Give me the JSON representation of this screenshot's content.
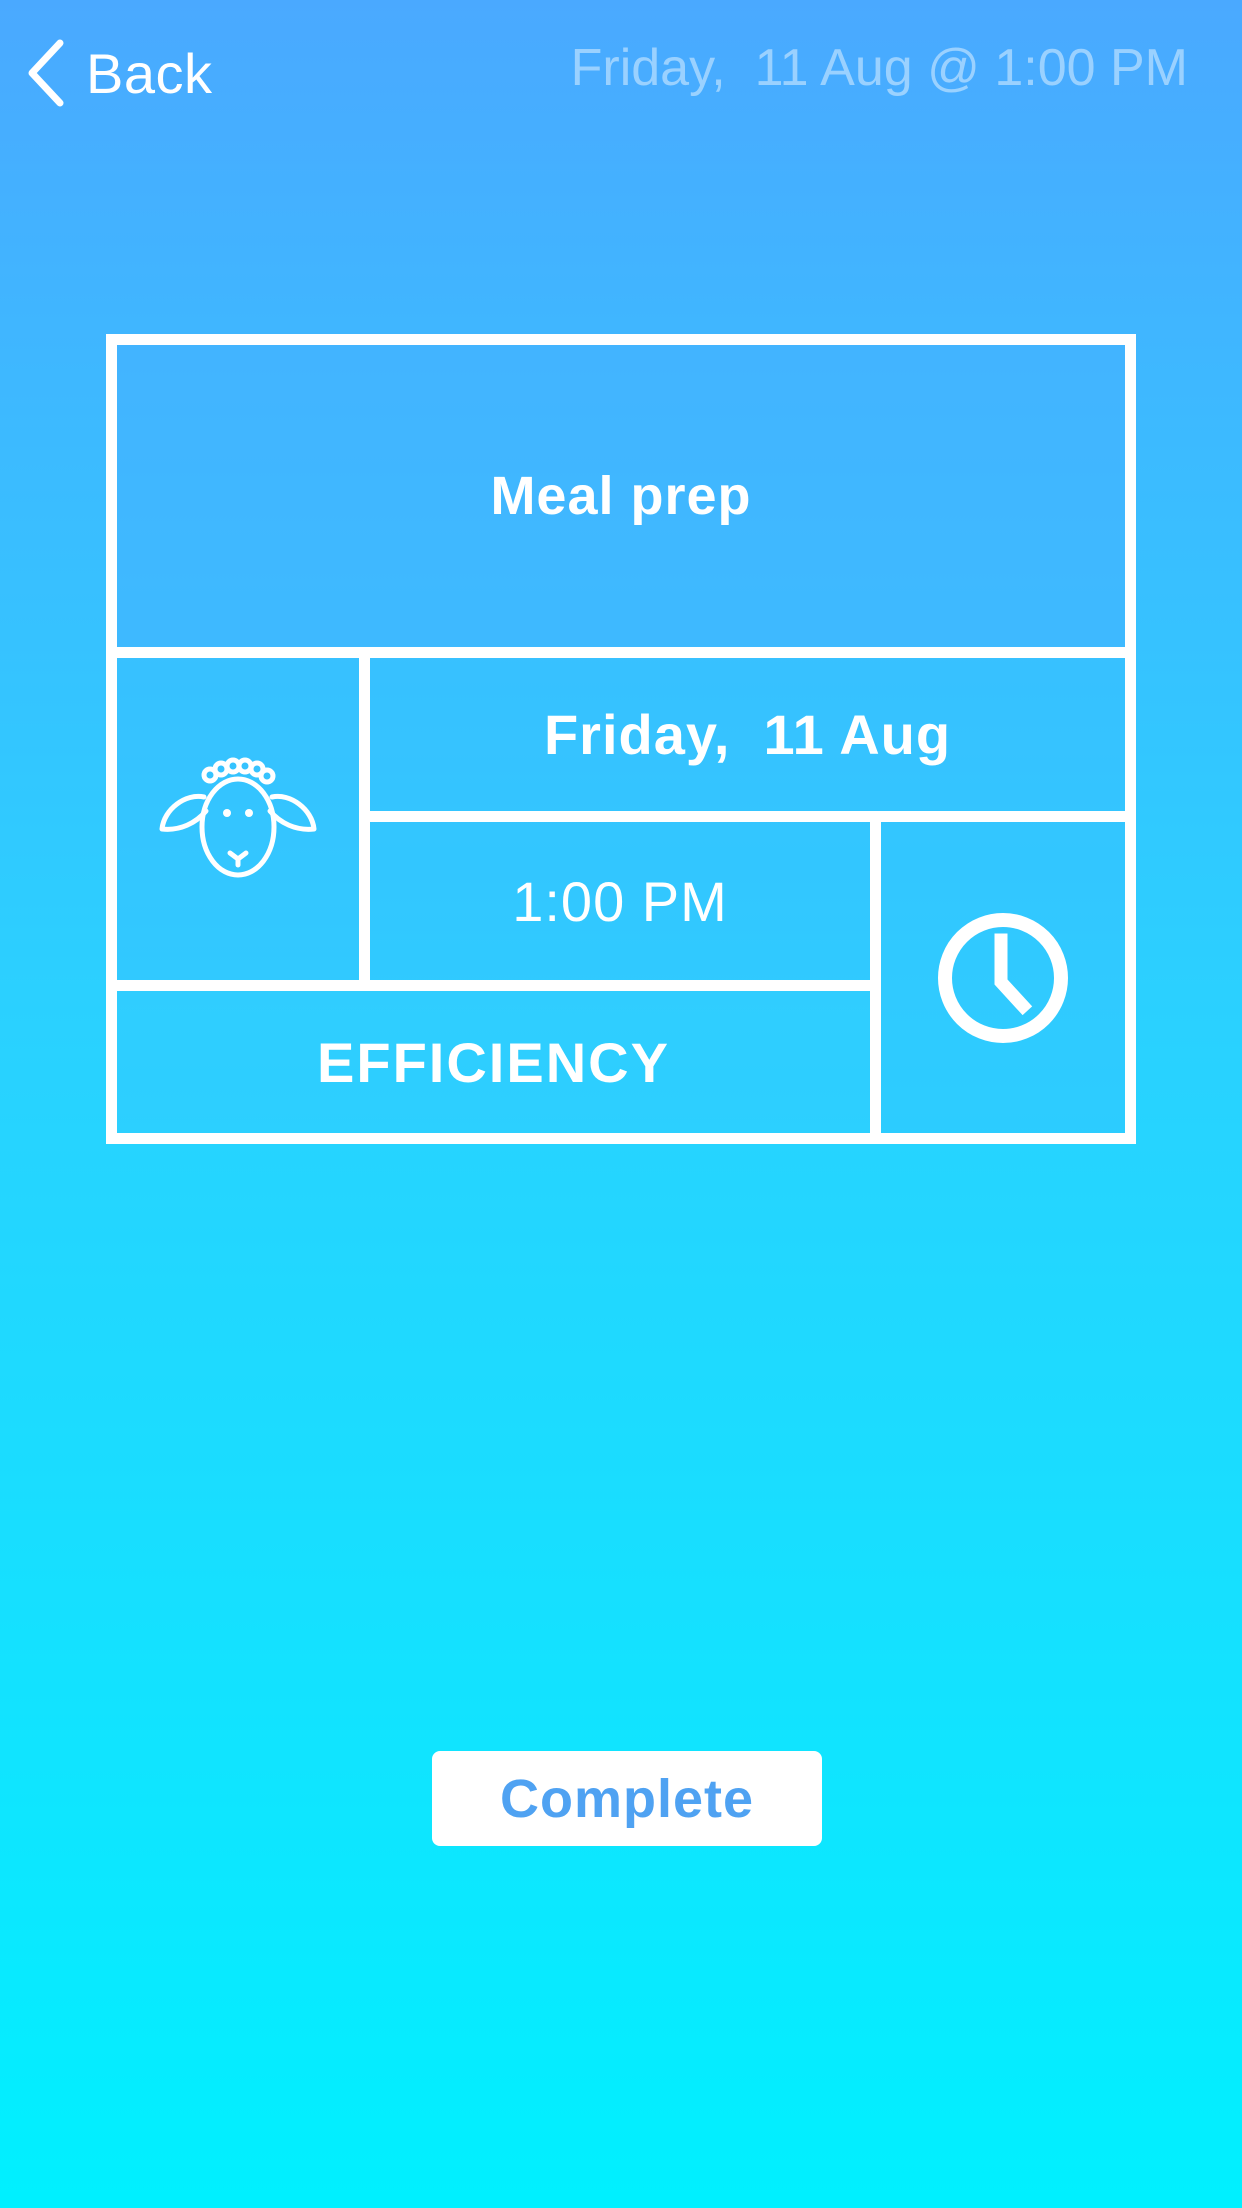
{
  "nav": {
    "back_label": "Back",
    "title": "Friday,  11 Aug @ 1:00 PM"
  },
  "task": {
    "title": "Meal prep",
    "date": "Friday,  11 Aug",
    "time": "1:00 PM",
    "category": "EFFICIENCY",
    "avatar_icon": "sheep-icon",
    "time_icon": "clock-icon"
  },
  "actions": {
    "complete_label": "Complete"
  },
  "colors": {
    "gradient_top": "#4aa9ff",
    "gradient_bottom": "#00f0ff",
    "button_text": "#4fa2f2",
    "line": "#ffffff"
  }
}
